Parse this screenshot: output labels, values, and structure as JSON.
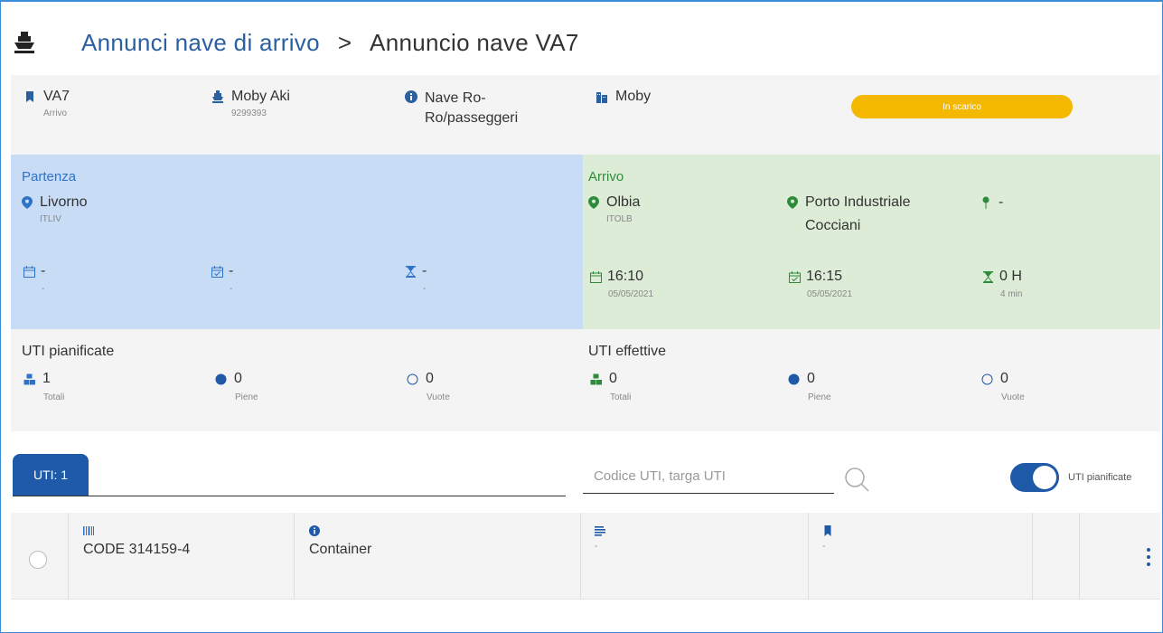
{
  "header": {
    "breadcrumb_parent": "Annunci nave di arrivo",
    "separator": ">",
    "breadcrumb_current": "Annuncio nave VA7"
  },
  "info": {
    "voyage": {
      "code": "VA7",
      "type": "Arrivo"
    },
    "ship": {
      "name": "Moby Aki",
      "imo": "9299393"
    },
    "ship_type": {
      "line1": "Nave Ro-",
      "line2": "Ro/passeggeri"
    },
    "company": "Moby",
    "status": "In scarico"
  },
  "departure": {
    "title": "Partenza",
    "port": "Livorno",
    "port_code": "ITLIV",
    "planned": {
      "time": "-",
      "date": "-"
    },
    "actual": {
      "time": "-",
      "date": "-"
    },
    "duration": {
      "value": "-",
      "sub": "-"
    }
  },
  "arrival": {
    "title": "Arrivo",
    "port": "Olbia",
    "port_code": "ITOLB",
    "terminal": {
      "line1": "Porto Industriale",
      "line2": "Cocciani"
    },
    "berth": "-",
    "planned": {
      "time": "16:10",
      "date": "05/05/2021"
    },
    "actual": {
      "time": "16:15",
      "date": "05/05/2021"
    },
    "duration": {
      "value": "0 H",
      "sub": "4 min"
    }
  },
  "uti_planned": {
    "title": "UTI pianificate",
    "total": "1",
    "total_label": "Totali",
    "full": "0",
    "full_label": "Piene",
    "empty": "0",
    "empty_label": "Vuote"
  },
  "uti_actual": {
    "title": "UTI effettive",
    "total": "0",
    "total_label": "Totali",
    "full": "0",
    "full_label": "Piene",
    "empty": "0",
    "empty_label": "Vuote"
  },
  "toolbar": {
    "tab_label": "UTI: 1",
    "search_placeholder": "Codice UTI, targa UTI",
    "toggle_label": "UTI pianificate"
  },
  "rows": [
    {
      "code": "CODE 314159-4",
      "type": "Container",
      "col3": "-",
      "col4": "-"
    }
  ],
  "colors": {
    "primary": "#1e5aa8",
    "link": "#2c5fa0",
    "status": "#f5b800",
    "departure_bg": "#c8dcf6",
    "arrival_bg": "#dcecd6",
    "departure_title": "#2f73c8",
    "arrival_title": "#2e8b3b"
  }
}
